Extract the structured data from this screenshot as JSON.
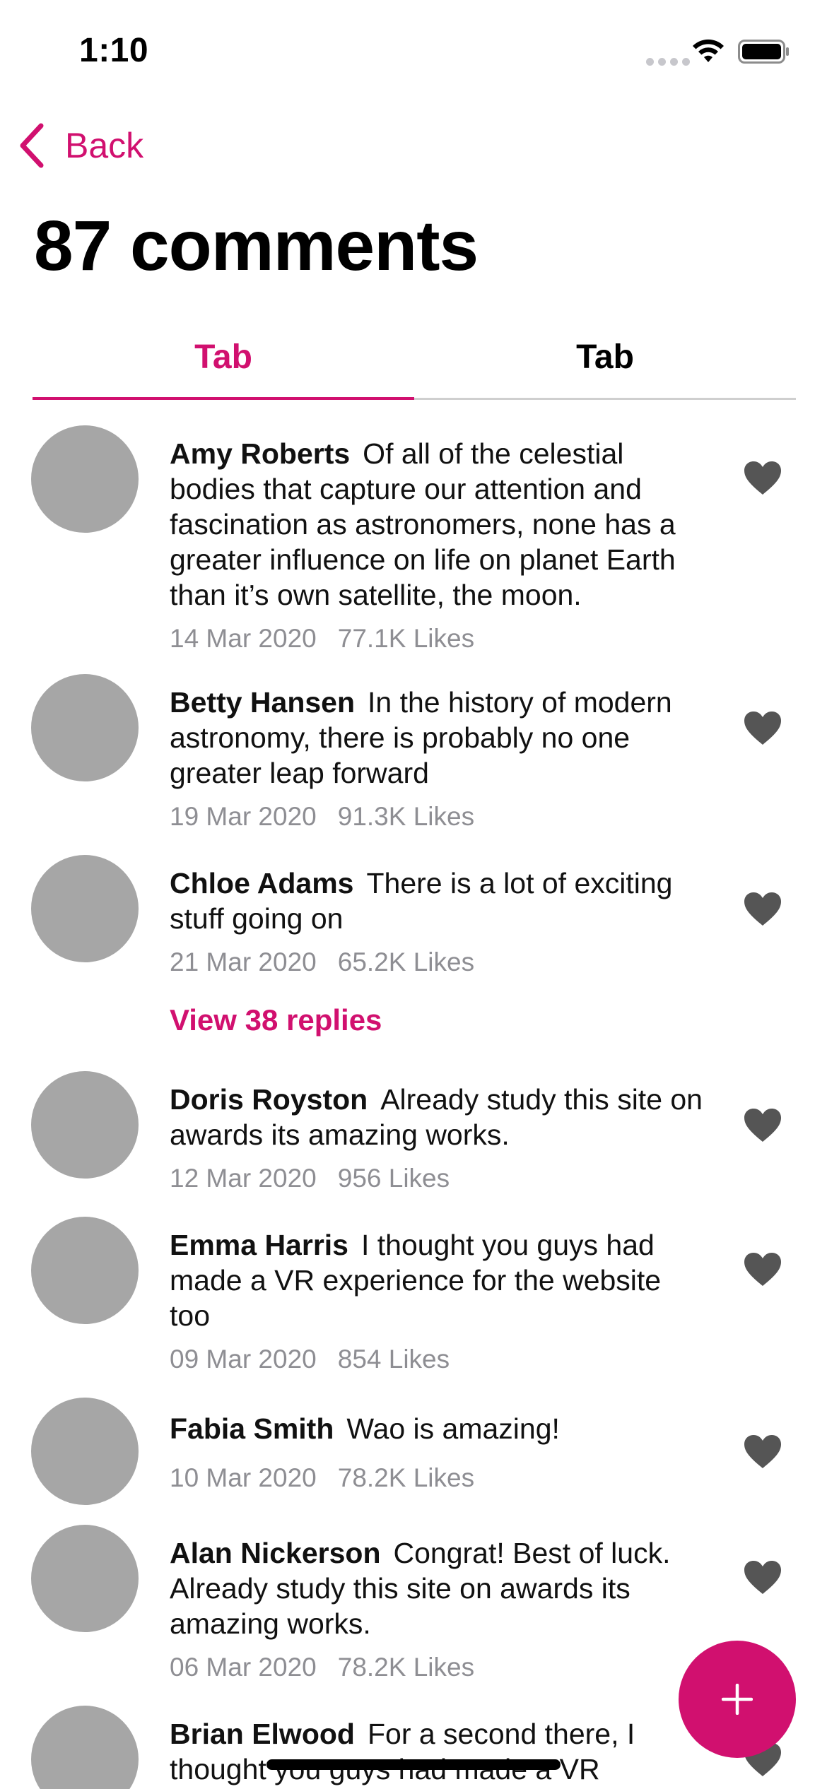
{
  "status_bar": {
    "time": "1:10"
  },
  "nav": {
    "back_label": "Back"
  },
  "page": {
    "title": "87 comments"
  },
  "tabs": [
    {
      "label": "Tab",
      "active": true
    },
    {
      "label": "Tab",
      "active": false
    }
  ],
  "comments": [
    {
      "author": "Amy Roberts",
      "text": "Of all of the celestial bodies that capture our attention and fascination as astronomers, none has a greater influence on life on planet Earth than it’s own satellite, the moon.",
      "date": "14 Mar 2020",
      "likes": "77.1K Likes"
    },
    {
      "author": "Betty Hansen",
      "text": "In the history of modern astronomy, there is probably no one greater leap forward",
      "date": "19 Mar 2020",
      "likes": "91.3K Likes"
    },
    {
      "author": "Chloe Adams",
      "text": "There is a lot of exciting stuff going on",
      "date": "21 Mar 2020",
      "likes": "65.2K Likes"
    },
    {
      "author": "Doris Royston",
      "text": "Already study this site on awards its amazing works.",
      "date": "12 Mar 2020",
      "likes": "956 Likes"
    },
    {
      "author": "Emma Harris",
      "text": "I thought you guys had made a VR experience for the website too",
      "date": "09 Mar 2020",
      "likes": "854 Likes"
    },
    {
      "author": "Fabia Smith",
      "text": "Wao is amazing!",
      "date": "10 Mar 2020",
      "likes": "78.2K Likes"
    },
    {
      "author": "Alan Nickerson",
      "text": "Congrat! Best of luck. Already study this site on awards its amazing works.",
      "date": "06 Mar 2020",
      "likes": "78.2K Likes"
    },
    {
      "author": "Brian Elwood",
      "text": "For a second there, I thought you guys had made a VR",
      "date": "",
      "likes": ""
    }
  ],
  "replies": {
    "label": "View 38 replies"
  },
  "fab": {
    "icon": "plus-icon"
  },
  "colors": {
    "accent": "#d1106f",
    "avatar": "#a6a6a6",
    "like_icon": "#555555",
    "meta_text": "#8e8e93"
  }
}
